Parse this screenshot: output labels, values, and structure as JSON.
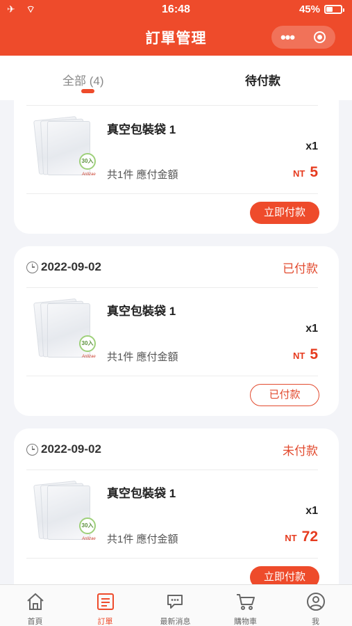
{
  "status_bar": {
    "left": "✈ ⌔",
    "time": "16:48",
    "battery": "45%",
    "battery_level": 0.45
  },
  "header": {
    "title": "訂單管理",
    "menu_dots": "•••"
  },
  "tabs": [
    {
      "label": "全部 (4)"
    },
    {
      "label": "待付款"
    }
  ],
  "orders": [
    {
      "date": "",
      "status": "",
      "product_name": "真空包裝袋 1",
      "badge": "30入",
      "brand": "Anlizae",
      "qty": "x1",
      "summary": "共1件 應付金額",
      "currency": "NT",
      "amount": "5",
      "action": "立即付款"
    },
    {
      "date": "2022-09-02",
      "status": "已付款",
      "product_name": "真空包裝袋 1",
      "badge": "30入",
      "brand": "Anlizae",
      "qty": "x1",
      "summary": "共1件 應付金額",
      "currency": "NT",
      "amount": "5",
      "action": "已付款"
    },
    {
      "date": "2022-09-02",
      "status": "未付款",
      "product_name": "真空包裝袋 1",
      "badge": "30入",
      "brand": "Anlizae",
      "qty": "x1",
      "summary": "共1件 應付金額",
      "currency": "NT",
      "amount": "72",
      "action": "立即付款"
    }
  ],
  "bottom_nav": [
    {
      "label": "首頁",
      "icon": "home-icon"
    },
    {
      "label": "訂單",
      "icon": "orders-icon"
    },
    {
      "label": "最新消息",
      "icon": "chat-icon"
    },
    {
      "label": "購物車",
      "icon": "cart-icon"
    },
    {
      "label": "我",
      "icon": "user-icon"
    }
  ],
  "colors": {
    "brand": "#ee4b2b",
    "price": "#e63b1f",
    "background": "#f3f4f8"
  }
}
